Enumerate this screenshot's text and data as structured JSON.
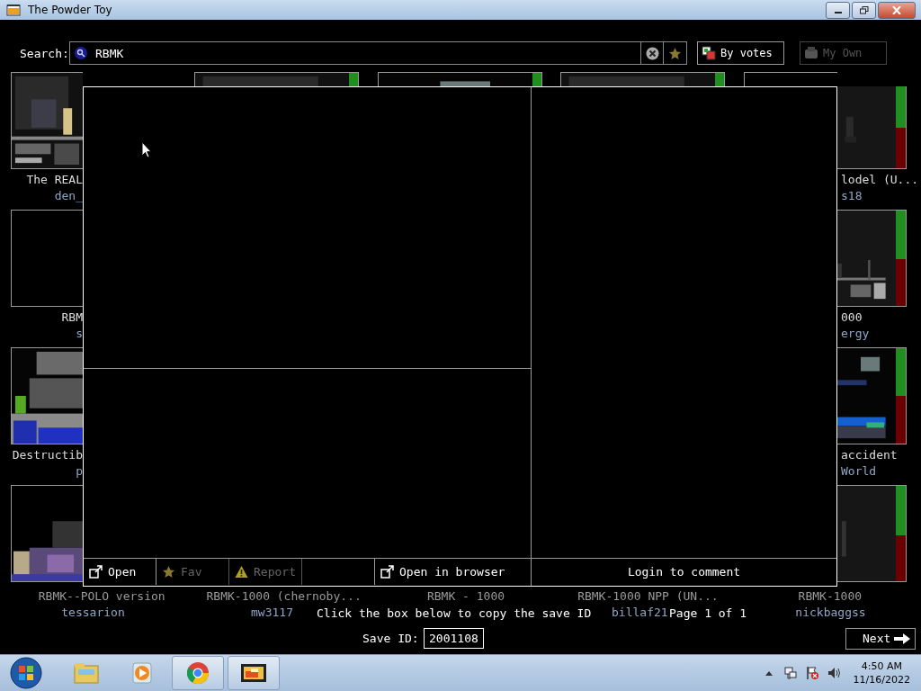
{
  "window": {
    "title": "The Powder Toy"
  },
  "search": {
    "label": "Search:",
    "value": "RBMK"
  },
  "toolbar": [
    {
      "kind": "sort",
      "label": "By votes",
      "disabled": false
    },
    {
      "kind": "mine",
      "label": "My Own",
      "disabled": true
    }
  ],
  "left_column": [
    {
      "title": "The REAL",
      "author": "den_"
    },
    {
      "title": "RBM",
      "author": "s"
    },
    {
      "title": "Destructib",
      "author": "p"
    }
  ],
  "right_column": [
    {
      "title": "lodel (U...",
      "author": "s18",
      "level": 0.5
    },
    {
      "title": "000",
      "author": "ergy",
      "level": 0.51
    },
    {
      "title": "accident",
      "author": "World",
      "level": 0.5
    },
    {
      "level": 0.52
    }
  ],
  "bottom_row": [
    {
      "title": "RBMK--POLO version",
      "author": "tessarion"
    },
    {
      "title": "RBMK-1000 (chernoby...",
      "author": "mw3117"
    },
    {
      "title": "RBMK - 1000"
    },
    {
      "title": "RBMK-1000 NPP (UN...",
      "author": "billaf21"
    },
    {
      "title": "RBMK-1000",
      "author": "nickbaggss"
    }
  ],
  "save_dialog": {
    "buttons": [
      {
        "kind": "open",
        "label": "Open",
        "disabled": false
      },
      {
        "kind": "fav",
        "label": "Fav",
        "disabled": true
      },
      {
        "kind": "report",
        "label": "Report",
        "disabled": true
      }
    ],
    "browser_button": "Open in browser",
    "comment_prompt": "Login to comment",
    "copy_hint": "Click the box below to copy the save ID",
    "save_id_label": "Save ID:",
    "save_id": "2001108"
  },
  "pagination": {
    "label": "Page 1 of 1",
    "next": "Next"
  },
  "taskbar": {
    "apps": [
      {
        "kind": "explorer",
        "running": false
      },
      {
        "kind": "media",
        "running": false
      },
      {
        "kind": "chrome",
        "running": true
      },
      {
        "kind": "toy",
        "running": true
      }
    ],
    "time": "4:50 AM",
    "date": "11/16/2022"
  }
}
